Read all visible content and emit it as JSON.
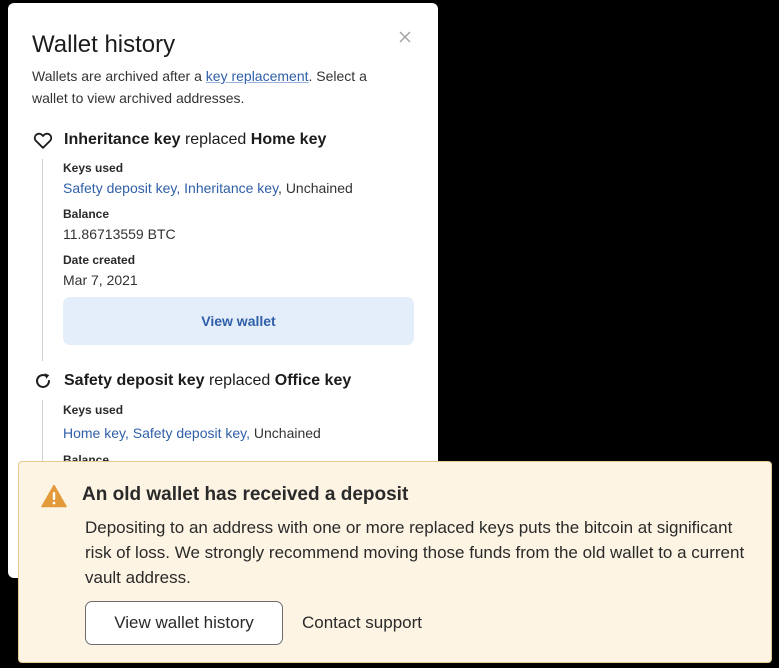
{
  "panel": {
    "title": "Wallet history",
    "subtitle_before": "Wallets are archived after a ",
    "subtitle_link": "key replacement",
    "subtitle_after": ". Select a wallet to view archived addresses.",
    "close_icon": "close-icon",
    "entries": [
      {
        "icon": "heart-icon",
        "new_key": "Inheritance key",
        "verb": " replaced ",
        "old_key": "Home key",
        "keys_used_label": "Keys used",
        "keys_links": "Safety deposit key, Inheritance key",
        "keys_plain": ", Unchained",
        "balance_label": "Balance",
        "balance_value": "11.86713559 BTC",
        "date_label": "Date created",
        "date_value": "Mar 7, 2021",
        "button_label": "View wallet"
      },
      {
        "icon": "refresh-icon",
        "new_key": "Safety deposit key",
        "verb": " replaced ",
        "old_key": "Office key",
        "keys_used_label": "Keys used",
        "keys_links": "Home key, Safety deposit key,",
        "keys_plain": " Unchained",
        "balance_label": "Balance"
      }
    ]
  },
  "alert": {
    "icon": "warning-icon",
    "accent_color": "#e39a3a",
    "title": "An old wallet has received a deposit",
    "body": "Depositing to an address with one or more replaced keys puts the bitcoin at significant risk of loss. We strongly recommend moving those funds from the old wallet to a current vault address.",
    "primary_button": "View wallet history",
    "secondary_link": "Contact support"
  }
}
